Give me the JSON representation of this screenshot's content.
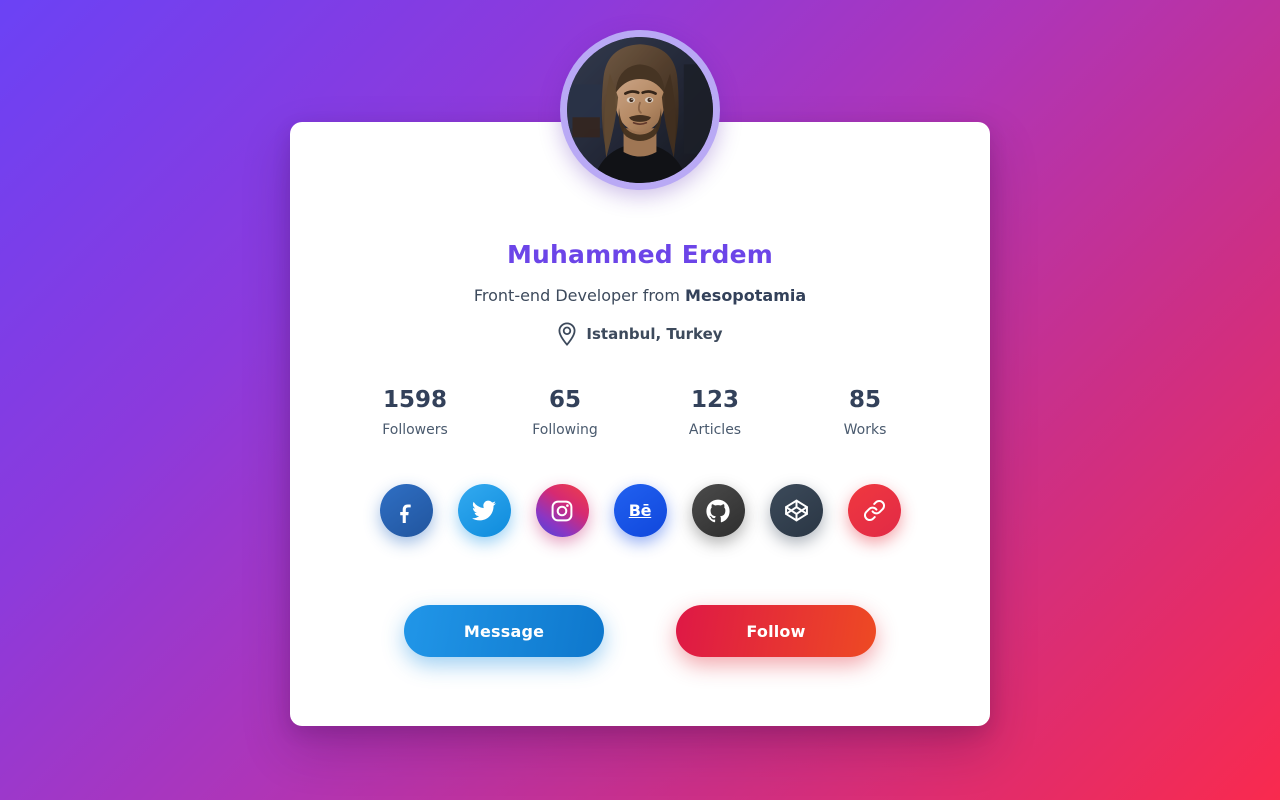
{
  "theme": {
    "background_gradient_start": "#6B42F5",
    "background_gradient_mid": "#AE35B8",
    "background_gradient_end": "#F92A4E",
    "card_background": "#FFFFFF",
    "name_color": "#6C45E8",
    "text_color": "#3D4A5C",
    "avatar_ring_color": "#B9A9F5"
  },
  "profile": {
    "avatar_alt": "profile-photo",
    "name": "Muhammed Erdem",
    "role_prefix": "Front-end Developer from",
    "role_highlight": "Mesopotamia",
    "location_icon": "map-pin-icon",
    "location": "Istanbul, Turkey"
  },
  "stats": [
    {
      "value": "1598",
      "label": "Followers",
      "name": "followers"
    },
    {
      "value": "65",
      "label": "Following",
      "name": "following"
    },
    {
      "value": "123",
      "label": "Articles",
      "name": "articles"
    },
    {
      "value": "85",
      "label": "Works",
      "name": "works"
    }
  ],
  "socials": [
    {
      "icon": "facebook-icon",
      "label": "Facebook",
      "color": "#2F6FC4"
    },
    {
      "icon": "twitter-icon",
      "label": "Twitter",
      "color": "#1E96E6"
    },
    {
      "icon": "instagram-icon",
      "label": "Instagram",
      "color": "#D62A72"
    },
    {
      "icon": "behance-icon",
      "label": "Behance",
      "color": "#1A54E6",
      "glyph": "Bē"
    },
    {
      "icon": "github-icon",
      "label": "GitHub",
      "color": "#3C3C3C"
    },
    {
      "icon": "codepen-icon",
      "label": "CodePen",
      "color": "#32404F"
    },
    {
      "icon": "link-icon",
      "label": "Website",
      "color": "#E62E3F"
    }
  ],
  "actions": {
    "message_label": "Message",
    "follow_label": "Follow"
  }
}
